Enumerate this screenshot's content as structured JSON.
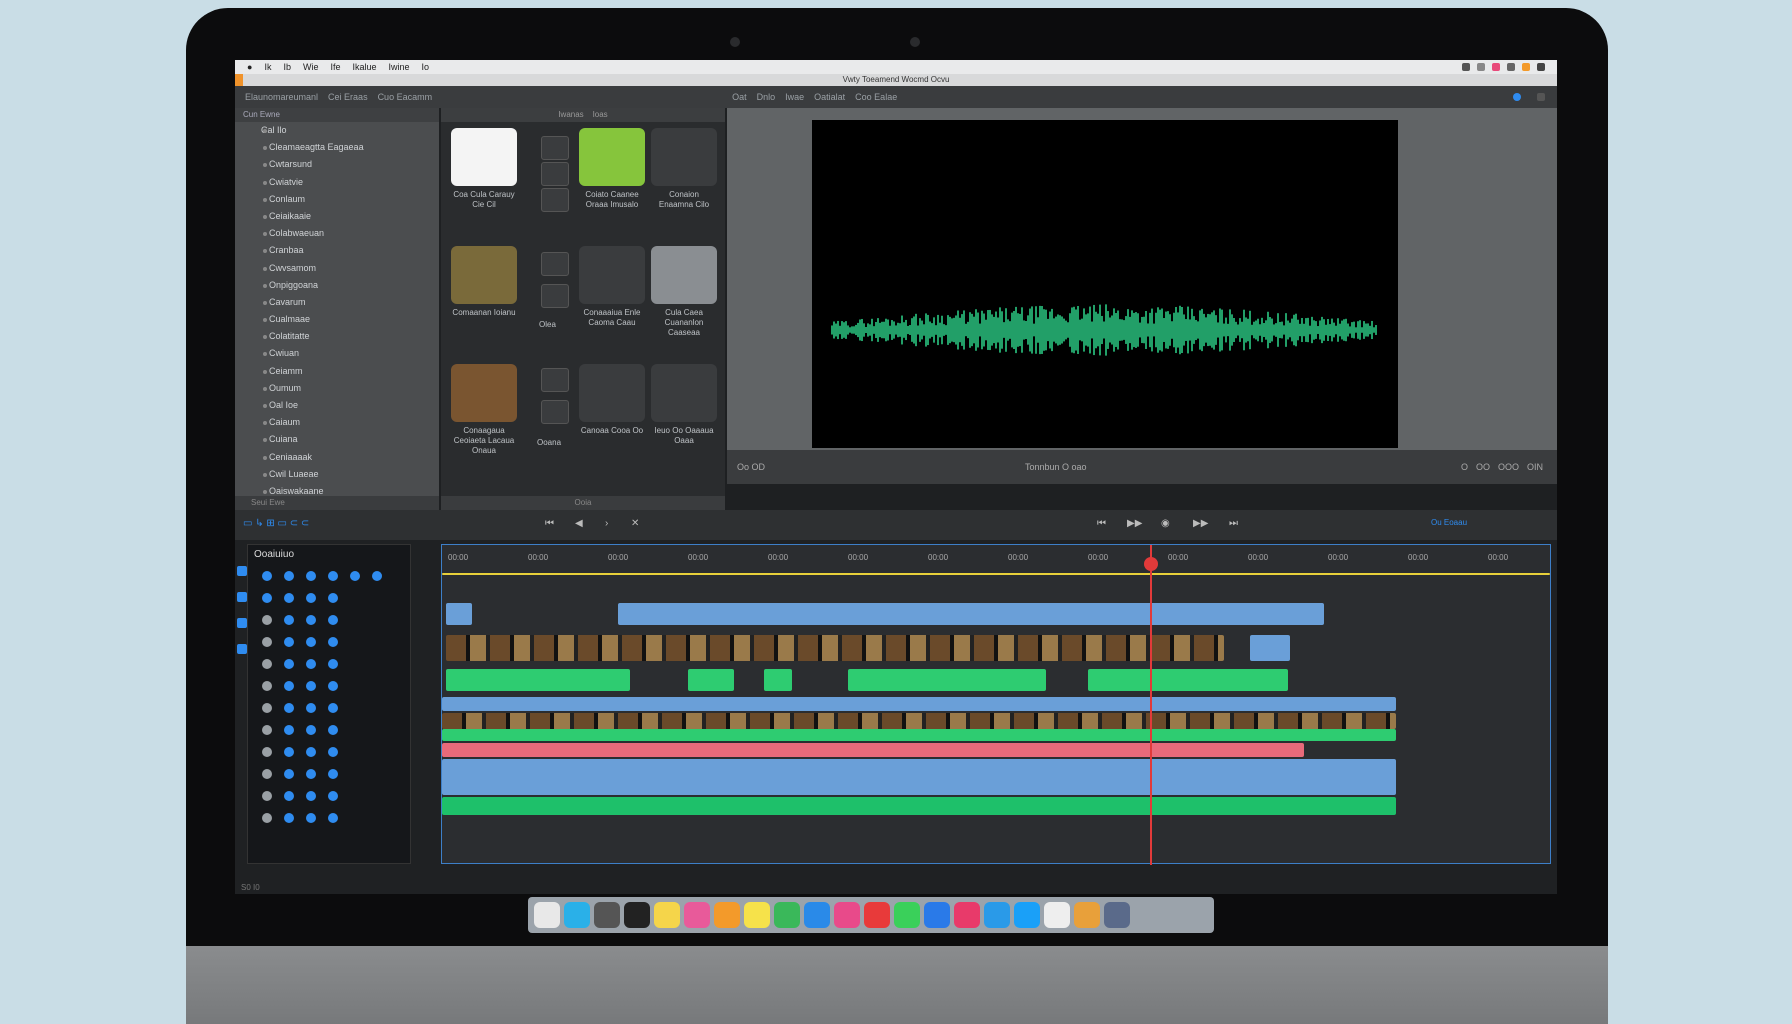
{
  "menubar": {
    "items": [
      "Ik",
      "Ib",
      "Wie",
      "Ife",
      "Ikalue",
      "Iwine",
      "Io"
    ]
  },
  "titlebar": {
    "title": "Vwty Toeamend Wocmd Ocvu"
  },
  "toolbar": {
    "left": [
      "Elaunomareumanl",
      "Cei Eraas",
      "Cuo Eacamm"
    ],
    "center": [
      "Oat",
      "Dnlo",
      "Iwae",
      "Oatialat",
      "Coo Ealae"
    ]
  },
  "library": {
    "header": "Cun Ewne",
    "group": "Cal Ilo",
    "items": [
      "Cleamaeagtta Eagaeaa",
      "Cwtarsund",
      "Cwiatvie",
      "Conlaum",
      "Ceiaikaaie",
      "Colabwaeuan",
      "Cranbaa",
      "Cwvsamom",
      "Onpiggoana",
      "Cavarum",
      "Cualmaae",
      "Colatitatte",
      "Cwiuan",
      "Ceiamm",
      "Oumum",
      "Oal Ioe",
      "Caiaum",
      "Cuiana",
      "Ceniaaaak",
      "Cwil Luaeae",
      "Oaiswakaane"
    ],
    "footer": "Seui Ewe"
  },
  "browser": {
    "header_tabs": [
      "Iwanas",
      "Ioas"
    ],
    "tiles": [
      {
        "caption": "Coa Cula Carauy Cie Cil",
        "icon": "pen-tool-icon",
        "color": "#f4f4f4"
      },
      {
        "caption": "Coiato Caanee Oraaa Imusalo",
        "icon": "phone-icon",
        "color": "#86c53c"
      },
      {
        "caption": "Conaion Enaamna Cilo",
        "icon": "toggle-icon",
        "color": "#3a3c3e"
      },
      {
        "caption": "Comaanan Ioianu",
        "icon": "landscape-photo",
        "color": "#7a6a3a"
      },
      {
        "caption": "Conaaaiua Enle Caoma Caau",
        "icon": "refresh-icon",
        "color": "#3a3c3e"
      },
      {
        "caption": "Cula Caea Cuananlon Caaseaa",
        "icon": "monitor-icon",
        "color": "#8a8e92"
      },
      {
        "caption": "Conaagaua Ceoiaeta Lacaua Onaua",
        "icon": "portrait-photo",
        "color": "#7a5530"
      },
      {
        "caption": "Canoaa Cooa Oo",
        "icon": "gear-icon",
        "color": "#3a3c3e"
      },
      {
        "caption": "Ieuo Oo Oaaaua Oaaa",
        "icon": "circle-icon",
        "color": "#3a3c3e"
      }
    ],
    "side_labels": [
      "Olea",
      "Ooana"
    ],
    "footer": "Ooia"
  },
  "viewer": {
    "timecode": "Oo OD",
    "center_label": "Tonnbun O oao",
    "right_controls": [
      "O",
      "OO",
      "OOO",
      "OIN"
    ]
  },
  "transport": {
    "left_icons": [
      "skip-back-icon",
      "rewind-icon",
      "play-icon",
      "shuffle-icon"
    ],
    "right_icons": [
      "skip-back-icon",
      "play-icon",
      "record-icon",
      "fast-forward-icon",
      "skip-forward-icon"
    ],
    "right_label": "Ou Eoaau"
  },
  "timeline": {
    "title": "Ooaiuiuo",
    "ruler": [
      "00:00",
      "00:00",
      "00:00",
      "00:00",
      "00:00",
      "00:00",
      "00:00",
      "00:00",
      "00:00",
      "00:00",
      "00:00",
      "00:00",
      "00:00",
      "00:00"
    ],
    "footer": "S0 I0"
  },
  "dock": {
    "apps": [
      {
        "name": "finder",
        "color": "#e8e8e8"
      },
      {
        "name": "mail",
        "color": "#2ab0e8"
      },
      {
        "name": "launchpad",
        "color": "#555"
      },
      {
        "name": "terminal",
        "color": "#222"
      },
      {
        "name": "notes",
        "color": "#f5d54a"
      },
      {
        "name": "photos",
        "color": "#e85a9a"
      },
      {
        "name": "pages",
        "color": "#f39a2a"
      },
      {
        "name": "stickies",
        "color": "#f6e24a"
      },
      {
        "name": "maps",
        "color": "#3ab85a"
      },
      {
        "name": "numbers",
        "color": "#2a8ae8"
      },
      {
        "name": "music",
        "color": "#e84a8a"
      },
      {
        "name": "chrome",
        "color": "#e83a3a"
      },
      {
        "name": "messages",
        "color": "#3ad05a"
      },
      {
        "name": "appstore",
        "color": "#2a7ae8"
      },
      {
        "name": "music2",
        "color": "#e83a6a"
      },
      {
        "name": "safari",
        "color": "#2a9ae8"
      },
      {
        "name": "finder2",
        "color": "#1aa0f8"
      },
      {
        "name": "calendar",
        "color": "#eee"
      },
      {
        "name": "paint",
        "color": "#e8a03a"
      },
      {
        "name": "preview",
        "color": "#5a6a8a"
      }
    ]
  },
  "colors": {
    "accent": "#2f8cf0",
    "playhead": "#e23a3a",
    "audio_green": "#2ecc71",
    "clip_blue": "#6a9fd8",
    "clip_red": "#e86a7a"
  }
}
